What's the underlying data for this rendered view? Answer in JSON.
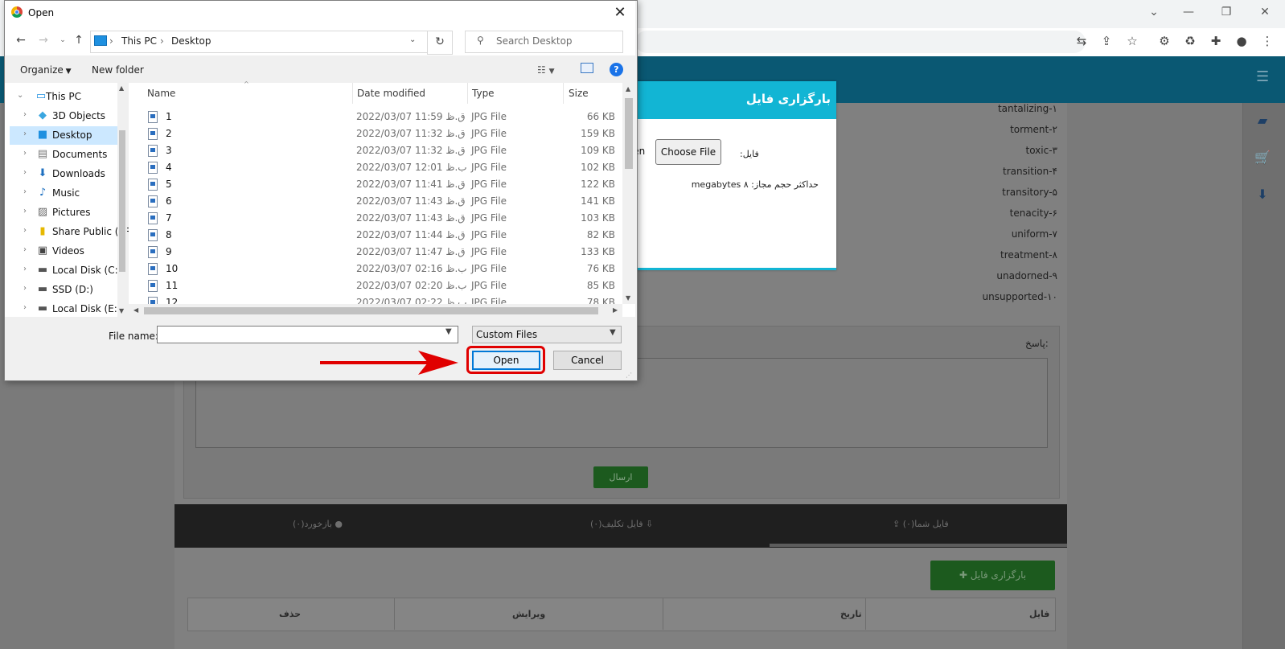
{
  "dialog": {
    "title": "Open",
    "breadcrumb": [
      "This PC",
      "Desktop"
    ],
    "search_placeholder": "Search Desktop",
    "organize_label": "Organize",
    "new_folder_label": "New folder",
    "columns": {
      "name": "Name",
      "date": "Date modified",
      "type": "Type",
      "size": "Size"
    },
    "tree": [
      {
        "label": "This PC",
        "icon": "computer-icon"
      },
      {
        "label": "3D Objects",
        "icon": "cube-icon"
      },
      {
        "label": "Desktop",
        "icon": "desktop-icon"
      },
      {
        "label": "Documents",
        "icon": "document-icon"
      },
      {
        "label": "Downloads",
        "icon": "download-icon"
      },
      {
        "label": "Music",
        "icon": "music-icon"
      },
      {
        "label": "Pictures",
        "icon": "picture-icon"
      },
      {
        "label": "Share Public (AR",
        "icon": "folder-icon"
      },
      {
        "label": "Videos",
        "icon": "video-icon"
      },
      {
        "label": "Local Disk (C:)",
        "icon": "drive-icon"
      },
      {
        "label": "SSD (D:)",
        "icon": "drive-icon"
      },
      {
        "label": "Local Disk (E:)",
        "icon": "drive-icon"
      }
    ],
    "files": [
      {
        "name": "1",
        "date": "2022/03/07 11:59 ق.ظ",
        "type": "JPG File",
        "size": "66 KB"
      },
      {
        "name": "2",
        "date": "2022/03/07 11:32 ق.ظ",
        "type": "JPG File",
        "size": "159 KB"
      },
      {
        "name": "3",
        "date": "2022/03/07 11:32 ق.ظ",
        "type": "JPG File",
        "size": "109 KB"
      },
      {
        "name": "4",
        "date": "2022/03/07 12:01 ب.ظ",
        "type": "JPG File",
        "size": "102 KB"
      },
      {
        "name": "5",
        "date": "2022/03/07 11:41 ق.ظ",
        "type": "JPG File",
        "size": "122 KB"
      },
      {
        "name": "6",
        "date": "2022/03/07 11:43 ق.ظ",
        "type": "JPG File",
        "size": "141 KB"
      },
      {
        "name": "7",
        "date": "2022/03/07 11:43 ق.ظ",
        "type": "JPG File",
        "size": "103 KB"
      },
      {
        "name": "8",
        "date": "2022/03/07 11:44 ق.ظ",
        "type": "JPG File",
        "size": "82 KB"
      },
      {
        "name": "9",
        "date": "2022/03/07 11:47 ق.ظ",
        "type": "JPG File",
        "size": "133 KB"
      },
      {
        "name": "10",
        "date": "2022/03/07 02:16 ب.ظ",
        "type": "JPG File",
        "size": "76 KB"
      },
      {
        "name": "11",
        "date": "2022/03/07 02:20 ب.ظ",
        "type": "JPG File",
        "size": "85 KB"
      },
      {
        "name": "12",
        "date": "2022/03/07 02:22 ب.ظ",
        "type": "JPG File",
        "size": "78 KB"
      }
    ],
    "file_name_label": "File name:",
    "file_name_value": "",
    "filter_value": "Custom Files",
    "open_label": "Open",
    "cancel_label": "Cancel"
  },
  "modal": {
    "title": "بارگزاری فایل",
    "choose_file_label": "Choose File",
    "chosen_stub": "sen",
    "file_label": "فایل:",
    "max_size": "حداکثر حجم مجاز: ۸ megabytes"
  },
  "words": [
    "tantalizing-۱",
    "torment-۲",
    "toxic-۳",
    "transition-۴",
    "transitory-۵",
    "tenacity-۶",
    "uniform-۷",
    "treatment-۸",
    "unadorned-۹",
    "unsupported-۱۰"
  ],
  "answer": {
    "label": "پاسخ:",
    "send_label": "ارسال"
  },
  "tabs": {
    "my_files": "فایل شما(۰)",
    "assignment_file": "فایل تکلیف(۰)",
    "feedback": "بازخورد(۰)"
  },
  "files_panel": {
    "upload_label": "بارگزاری فایل",
    "headers": {
      "file": "فایل",
      "date": "تاریخ",
      "edit": "ویرایش",
      "delete": "حذف"
    }
  },
  "colors": {
    "accent": "#12b5d4",
    "highlight": "#e00000",
    "navbar": "#0a5873",
    "selection": "#cce8ff"
  }
}
